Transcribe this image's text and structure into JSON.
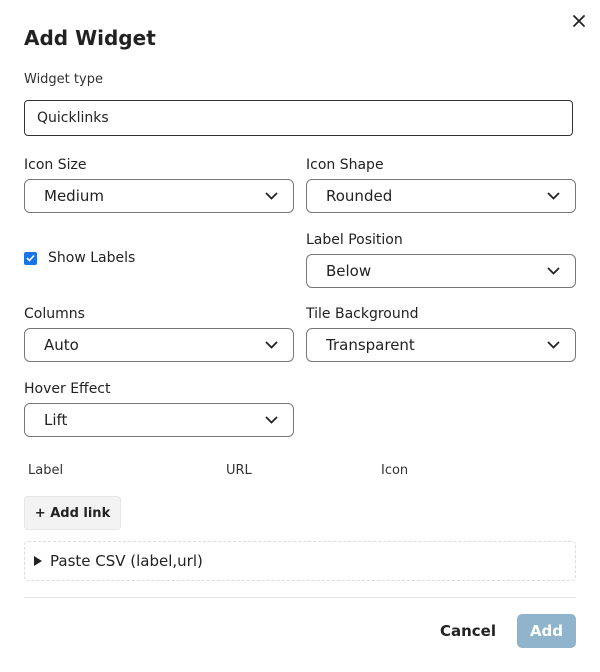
{
  "dialog": {
    "title": "Add Widget",
    "close_icon": "close-icon"
  },
  "widget_type": {
    "label": "Widget type",
    "value": "Quicklinks"
  },
  "icon_size": {
    "label": "Icon Size",
    "value": "Medium"
  },
  "icon_shape": {
    "label": "Icon Shape",
    "value": "Rounded"
  },
  "show_labels": {
    "label": "Show Labels",
    "checked": true
  },
  "label_position": {
    "label": "Label Position",
    "value": "Below"
  },
  "columns": {
    "label": "Columns",
    "value": "Auto"
  },
  "tile_background": {
    "label": "Tile Background",
    "value": "Transparent"
  },
  "hover_effect": {
    "label": "Hover Effect",
    "value": "Lift"
  },
  "links_table": {
    "headers": [
      "Label",
      "URL",
      "Icon"
    ]
  },
  "add_link_label": "+ Add link",
  "paste_csv_label": "Paste CSV (label,url)",
  "footer": {
    "cancel_label": "Cancel",
    "add_label": "Add"
  },
  "colors": {
    "checkbox_accent": "#1a73e8",
    "add_button_disabled": "#8fb4cc"
  }
}
